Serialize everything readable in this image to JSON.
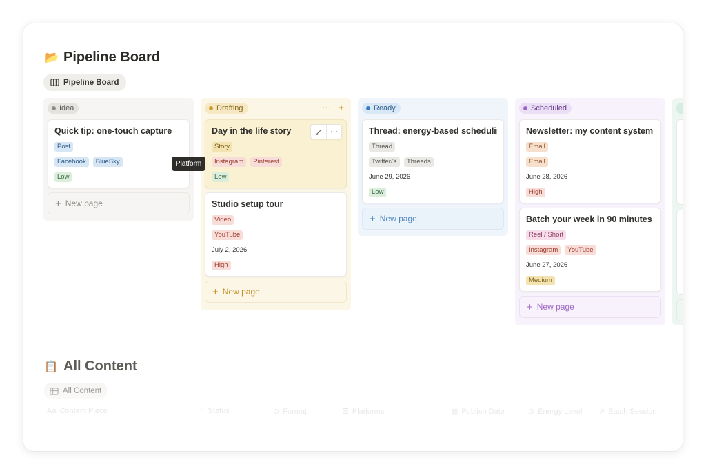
{
  "page": {
    "title": "Pipeline Board",
    "title_emoji": "📂",
    "view_tab": "Pipeline Board"
  },
  "columns": [
    {
      "status": "Idea",
      "cards": [
        {
          "title": "Quick tip: one-touch capture",
          "format": "Post",
          "platforms": [
            "Facebook",
            "BlueSky"
          ],
          "date": "",
          "energy": "Low"
        }
      ],
      "new_page": "New page"
    },
    {
      "status": "Drafting",
      "actions": [
        "···",
        "+"
      ],
      "cards": [
        {
          "title": "Day in the life story",
          "format": "Story",
          "platforms": [
            "Instagram",
            "Pinterest"
          ],
          "date": "",
          "energy": "Low"
        },
        {
          "title": "Studio setup tour",
          "format": "Video",
          "platforms": [
            "YouTube"
          ],
          "date": "July 2, 2026",
          "energy": "High"
        }
      ],
      "new_page": "New page"
    },
    {
      "status": "Ready",
      "cards": [
        {
          "title": "Thread: energy-based scheduling",
          "format": "Thread",
          "platforms": [
            "Twitter/X",
            "Threads"
          ],
          "date": "June 29, 2026",
          "energy": "Low"
        }
      ],
      "new_page": "New page"
    },
    {
      "status": "Scheduled",
      "cards": [
        {
          "title": "Newsletter: my content system",
          "format": "Email",
          "platforms": [
            "Email"
          ],
          "date": "June 28, 2026",
          "energy": "High"
        },
        {
          "title": "Batch your week in 90 minutes",
          "format": "Reel / Short",
          "platforms": [
            "Instagram",
            "YouTube"
          ],
          "date": "June 27, 2026",
          "energy": "Medium"
        }
      ],
      "new_page": "New page"
    }
  ],
  "tooltip": "Platform",
  "section2": {
    "title": "All Content",
    "title_emoji": "📋",
    "view_tab": "All Content",
    "columns": [
      "Content Piece",
      "Status",
      "Format",
      "Platforms",
      "Publish Date",
      "Energy Level",
      "Batch Session"
    ]
  },
  "icons": {
    "board_view": "board-view-icon",
    "table_view": "table-view-icon",
    "edit": "pencil-icon",
    "more": "more-icon",
    "add": "plus-icon"
  },
  "colors": {
    "idea": "#8e8b86",
    "drafting": "#cf9a2e",
    "ready": "#3a7bc4",
    "scheduled": "#9b64c9"
  }
}
